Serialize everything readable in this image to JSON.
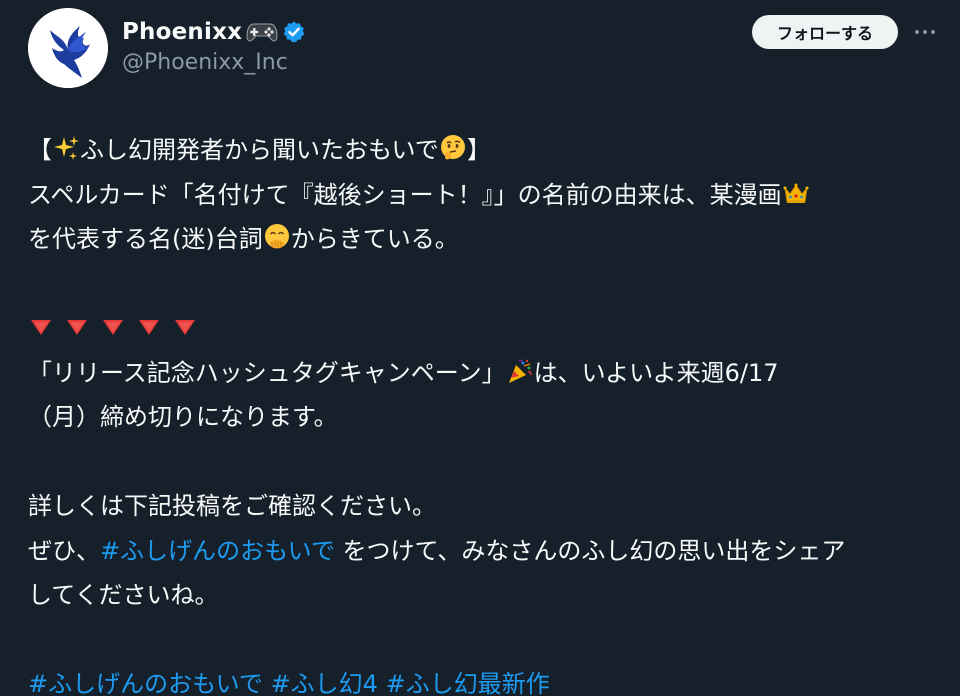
{
  "user": {
    "display_name": "Phoenixx",
    "handle": "@Phoenixx_Inc",
    "avatar_icon": "phoenix-logo",
    "name_emoji_icon": "gamepad-icon",
    "verified_icon": "verified-badge-icon"
  },
  "actions": {
    "follow_label": "フォローする",
    "more_icon": "more-dots-icon"
  },
  "post": {
    "line1_open": "【",
    "line1_text": "ふし幻開発者から聞いたおもいで",
    "line1_close": "】",
    "line2_text": "スペルカード「名付けて『越後ショート！』」の名前の由来は、某漫画",
    "line3_a": "を代表する名(迷)台詞",
    "line3_b": "からきている。",
    "line5_a": "「リリース記念ハッシュタグキャンペーン」",
    "line5_b": "は、いよいよ来週6/17",
    "line6": "（月）締め切りになります。",
    "line8": "詳しくは下記投稿をご確認ください。",
    "line9_a": "ぜひ、",
    "line9_hashtag": "#ふしげんのおもいで",
    "line9_b": " をつけて、みなさんのふし幻の思い出をシェア",
    "line10": "してくださいね。",
    "hashtags": [
      "#ふしげんのおもいで",
      "#ふし幻4",
      "#ふし幻最新作"
    ]
  },
  "emojis": {
    "sparkles": "sparkles-icon",
    "thinking": "thinking-face-icon",
    "crown": "crown-icon",
    "hand_over_mouth": "hand-over-mouth-face-icon",
    "triangle": "red-triangle-down-icon",
    "party_popper": "party-popper-icon"
  },
  "colors": {
    "background": "#15202b",
    "text": "#f7f9f9",
    "secondary_text": "#8b98a5",
    "link": "#1d9bf0",
    "verified": "#1d9bf0",
    "follow_bg": "#eff3f4"
  }
}
